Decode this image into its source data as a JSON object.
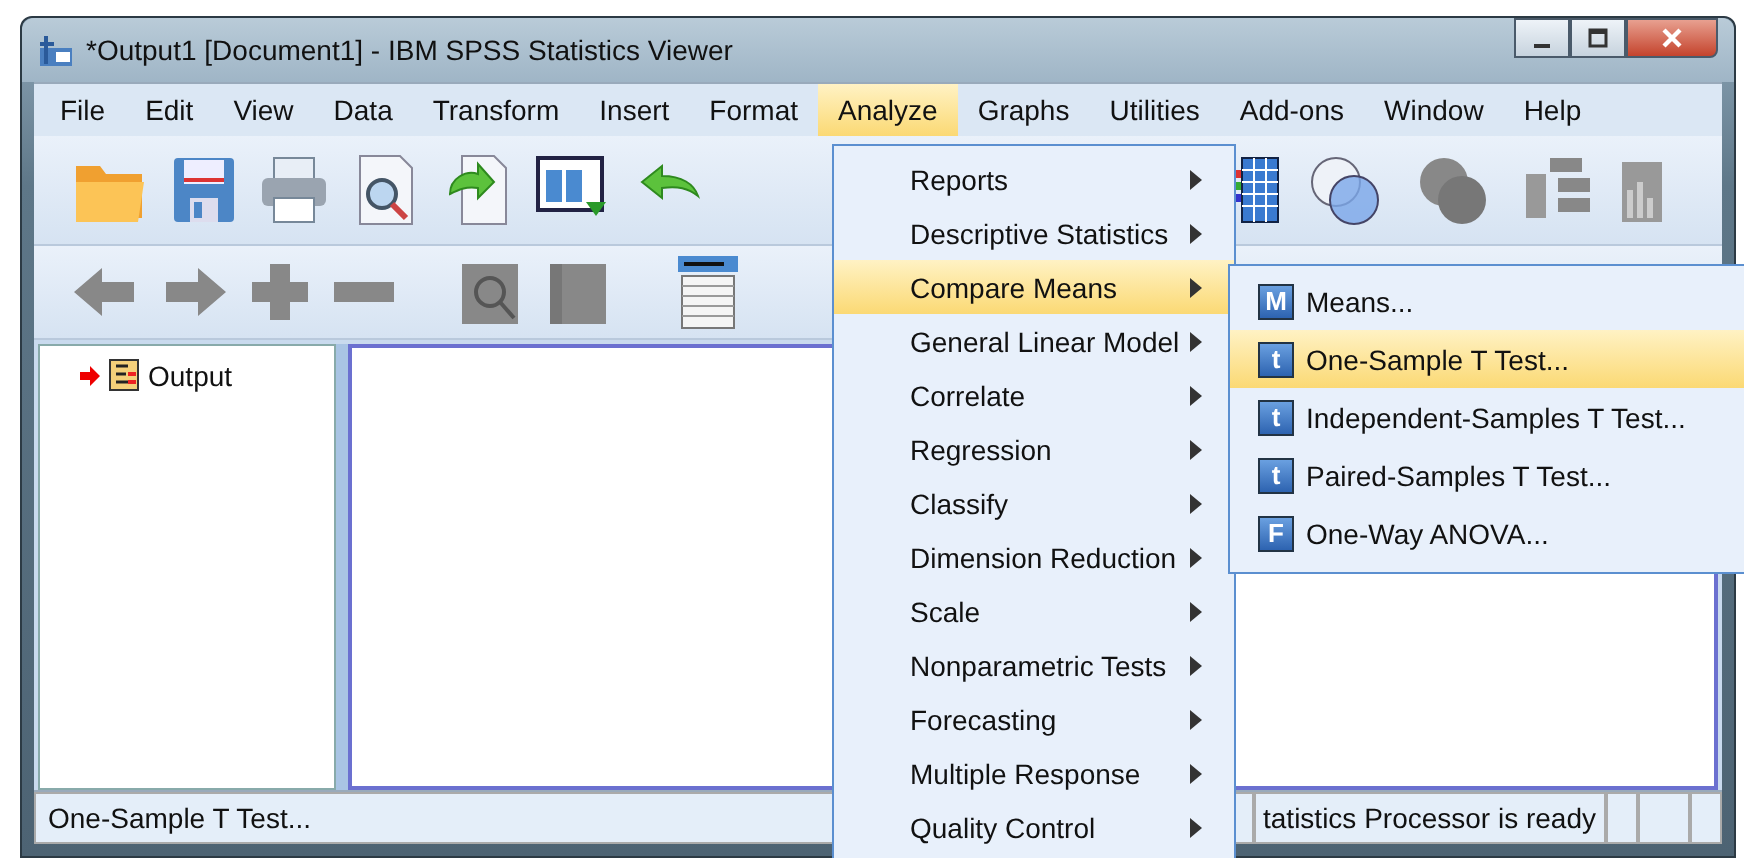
{
  "window": {
    "title": "*Output1 [Document1] - IBM SPSS Statistics Viewer"
  },
  "menu_bar": [
    {
      "label": "File",
      "selected": false
    },
    {
      "label": "Edit",
      "selected": false
    },
    {
      "label": "View",
      "selected": false
    },
    {
      "label": "Data",
      "selected": false
    },
    {
      "label": "Transform",
      "selected": false
    },
    {
      "label": "Insert",
      "selected": false
    },
    {
      "label": "Format",
      "selected": false
    },
    {
      "label": "Analyze",
      "selected": true
    },
    {
      "label": "Graphs",
      "selected": false
    },
    {
      "label": "Utilities",
      "selected": false
    },
    {
      "label": "Add-ons",
      "selected": false
    },
    {
      "label": "Window",
      "selected": false
    },
    {
      "label": "Help",
      "selected": false
    }
  ],
  "outline": [
    {
      "label": "Output",
      "current": true
    }
  ],
  "analyze_menu": [
    {
      "label": "Reports",
      "selected": false
    },
    {
      "label": "Descriptive Statistics",
      "selected": false
    },
    {
      "label": "Compare Means",
      "selected": true
    },
    {
      "label": "General Linear Model",
      "selected": false
    },
    {
      "label": "Correlate",
      "selected": false
    },
    {
      "label": "Regression",
      "selected": false
    },
    {
      "label": "Classify",
      "selected": false
    },
    {
      "label": "Dimension Reduction",
      "selected": false
    },
    {
      "label": "Scale",
      "selected": false
    },
    {
      "label": "Nonparametric Tests",
      "selected": false
    },
    {
      "label": "Forecasting",
      "selected": false
    },
    {
      "label": "Multiple Response",
      "selected": false
    },
    {
      "label": "Quality Control",
      "selected": false
    }
  ],
  "compare_means_submenu": [
    {
      "label": "Means...",
      "icon_text": "M",
      "selected": false
    },
    {
      "label": "One-Sample T Test...",
      "icon_text": "t",
      "selected": true
    },
    {
      "label": "Independent-Samples T Test...",
      "icon_text": "t",
      "selected": false
    },
    {
      "label": "Paired-Samples T Test...",
      "icon_text": "t",
      "selected": false
    },
    {
      "label": "One-Way ANOVA...",
      "icon_text": "F",
      "selected": false
    }
  ],
  "status_bar": {
    "message": "One-Sample T Test...",
    "processor_status": "tatistics Processor is ready"
  }
}
